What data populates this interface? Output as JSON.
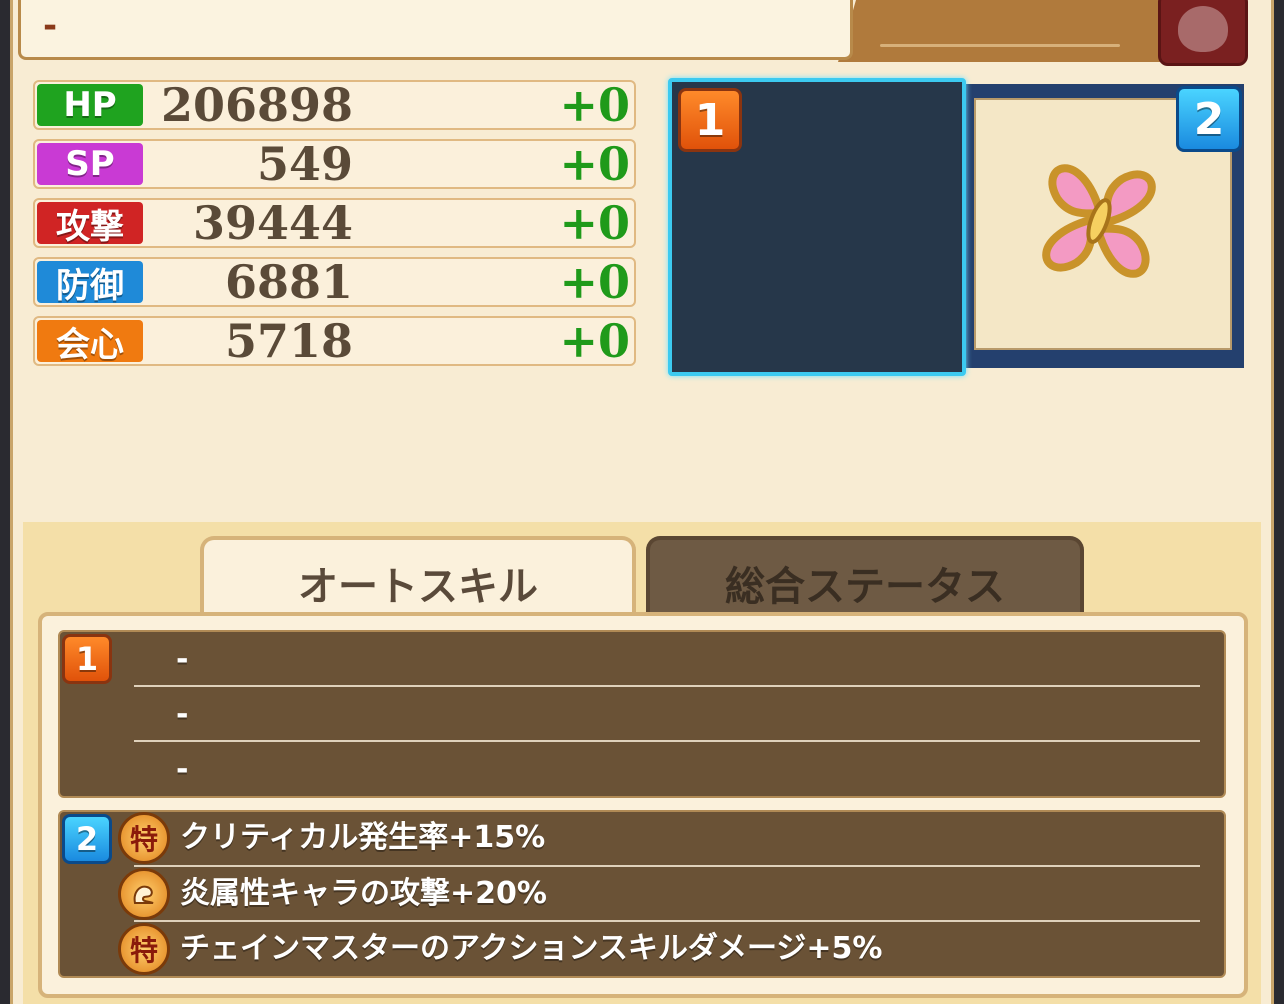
{
  "header": {
    "name_value": "-"
  },
  "stats": [
    {
      "label": "HP",
      "value": "206898",
      "bonus": "+0",
      "color": "#1fa31f"
    },
    {
      "label": "SP",
      "value": "549",
      "bonus": "+0",
      "color": "#c93ad4"
    },
    {
      "label": "攻撃",
      "value": "39444",
      "bonus": "+0",
      "color": "#d02424"
    },
    {
      "label": "防御",
      "value": "6881",
      "bonus": "+0",
      "color": "#1f8ad8"
    },
    {
      "label": "会心",
      "value": "5718",
      "bonus": "+0",
      "color": "#f07a10"
    }
  ],
  "slots": {
    "slot1_badge": "1",
    "slot2_badge": "2",
    "slot2_icon": "pink-clover-icon"
  },
  "tabs": {
    "auto_skill": "オートスキル",
    "total_status": "総合ステータス"
  },
  "skills": {
    "group1_badge": "1",
    "group1": [
      "-",
      "-",
      "-"
    ],
    "group2_badge": "2",
    "group2": [
      {
        "icon": "特",
        "text": "クリティカル発生率+15%"
      },
      {
        "icon": "",
        "text": "炎属性キャラの攻撃+20%"
      },
      {
        "icon": "特",
        "text": "チェインマスターのアクションスキルダメージ+5%"
      }
    ]
  }
}
